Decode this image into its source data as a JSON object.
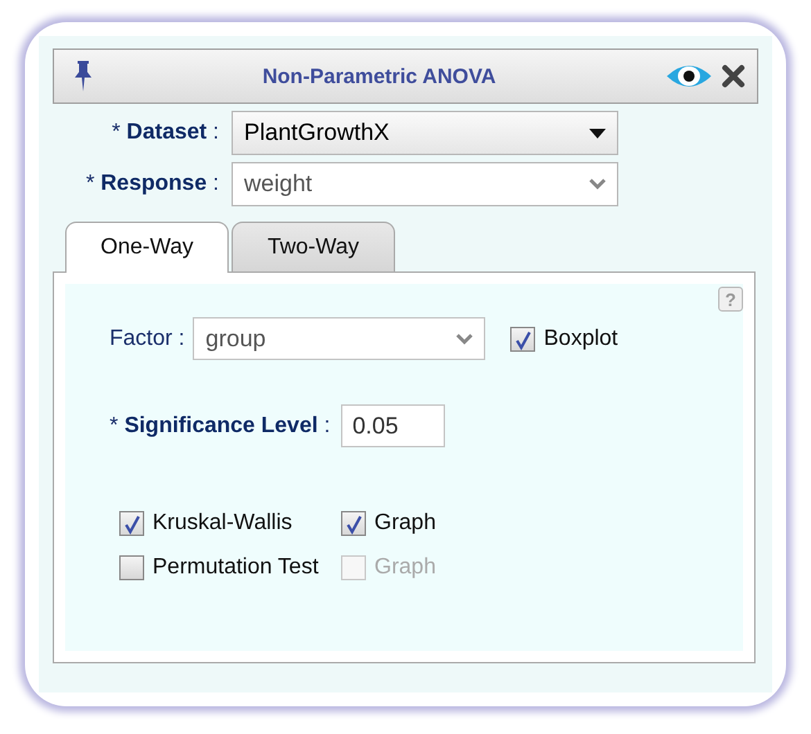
{
  "window": {
    "title": "Non-Parametric ANOVA"
  },
  "fields": [
    {
      "required_mark": "*",
      "label": "Dataset",
      "separator": ":",
      "value": "PlantGrowthX",
      "kind": "dropdown"
    },
    {
      "required_mark": "*",
      "label": "Response",
      "separator": ":",
      "value": "weight",
      "kind": "select"
    }
  ],
  "tabs": [
    {
      "label": "One-Way",
      "selected": true
    },
    {
      "label": "Two-Way",
      "selected": false
    }
  ],
  "help": {
    "label": "?"
  },
  "factor": {
    "label": "Factor",
    "separator": ":",
    "value": "group"
  },
  "boxplot": {
    "label": "Boxplot",
    "checked": true
  },
  "significance": {
    "required_mark": "*",
    "label": "Significance Level",
    "separator": ":",
    "value": "0.05"
  },
  "tests": [
    {
      "label": "Kruskal-Wallis",
      "checked": true,
      "graph": {
        "label": "Graph",
        "checked": true,
        "disabled": false
      }
    },
    {
      "label": "Permutation Test",
      "checked": false,
      "graph": {
        "label": "Graph",
        "checked": false,
        "disabled": true
      }
    }
  ]
}
